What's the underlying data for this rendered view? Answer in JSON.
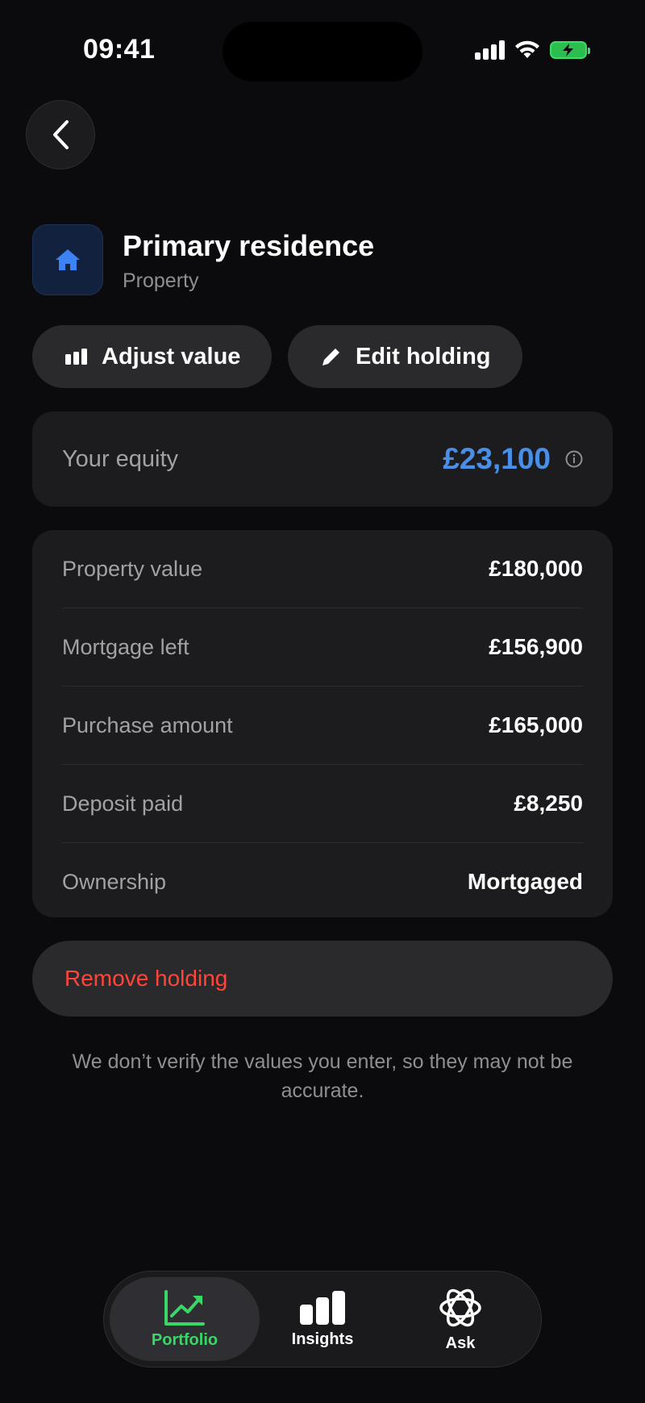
{
  "status": {
    "time": "09:41"
  },
  "header": {
    "title": "Primary residence",
    "subtitle": "Property"
  },
  "actions": {
    "adjust_label": "Adjust value",
    "edit_label": "Edit holding"
  },
  "equity": {
    "label": "Your equity",
    "value": "£23,100"
  },
  "details": [
    {
      "label": "Property value",
      "value": "£180,000"
    },
    {
      "label": "Mortgage left",
      "value": "£156,900"
    },
    {
      "label": "Purchase amount",
      "value": "£165,000"
    },
    {
      "label": "Deposit paid",
      "value": "£8,250"
    },
    {
      "label": "Ownership",
      "value": "Mortgaged"
    }
  ],
  "remove_label": "Remove holding",
  "disclaimer": "We don’t verify the values you enter, so they may not be accurate.",
  "tabs": [
    {
      "label": "Portfolio",
      "icon": "chart-trend-icon",
      "active": true
    },
    {
      "label": "Insights",
      "icon": "bar-chart-icon",
      "active": false
    },
    {
      "label": "Ask",
      "icon": "sparkle-orbit-icon",
      "active": false
    }
  ],
  "colors": {
    "accent_blue": "#4a8fe7",
    "accent_green": "#39d866",
    "danger_red": "#ff453a"
  }
}
